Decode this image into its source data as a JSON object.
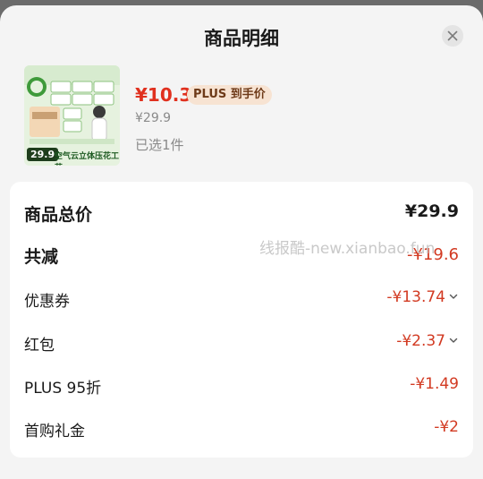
{
  "header": {
    "title": "商品明细"
  },
  "product": {
    "thumb_price": "29.9",
    "thumb_feature": "空气云立体压花工艺",
    "price": "¥10.3",
    "plus_badge": "PLUS 到手价",
    "original_price": "¥29.9",
    "selected": "已选1件"
  },
  "summary": {
    "total_label": "商品总价",
    "total_value": "¥29.9",
    "reduction_label": "共减",
    "reduction_value": "-¥19.6",
    "watermark": "线报酷-new.xianbao.fun",
    "items": [
      {
        "label": "优惠券",
        "value": "-¥13.74",
        "expandable": true
      },
      {
        "label": "红包",
        "value": "-¥2.37",
        "expandable": true
      },
      {
        "label": "PLUS 95折",
        "value": "-¥1.49",
        "expandable": false
      },
      {
        "label": "首购礼金",
        "value": "-¥2",
        "expandable": false
      }
    ]
  },
  "colors": {
    "price_red": "#e0301e",
    "discount_red": "#d23a22",
    "badge_bg": "#f7e3d2",
    "badge_text": "#6e3a18",
    "product_green": "#3f9a3b"
  }
}
